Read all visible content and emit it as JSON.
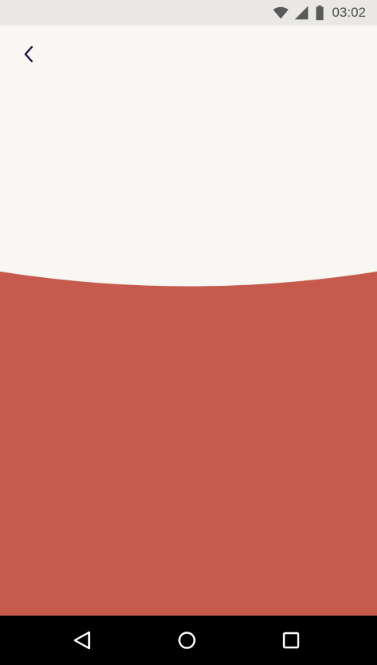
{
  "status_bar": {
    "time": "03:02",
    "icons": [
      "wifi-icon",
      "cellular-signal-icon",
      "battery-icon"
    ]
  },
  "toolbar": {
    "back_icon": "chevron-left-icon"
  },
  "colors": {
    "background": "#f8f7f3",
    "accent_panel": "#c65a4c",
    "status_bar": "#e9e8e4",
    "icon": "#1f1145"
  },
  "nav_bar": {
    "icons": [
      "back-triangle-icon",
      "home-circle-icon",
      "recents-square-icon"
    ]
  }
}
